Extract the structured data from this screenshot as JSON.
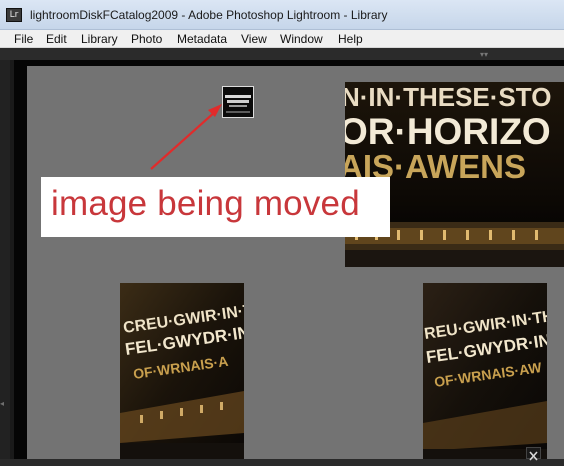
{
  "window": {
    "title": "lightroomDiskFCatalog2009 - Adobe Photoshop Lightroom - Library",
    "icon": "lightroom-app-icon",
    "icon_glyph": "Lr"
  },
  "menu": {
    "items": [
      "File",
      "Edit",
      "Library",
      "Photo",
      "Metadata",
      "View",
      "Window",
      "Help"
    ]
  },
  "annotation": {
    "text": "image being moved",
    "color": "#c8373b",
    "arrow_color": "#e12b2b"
  },
  "photos": [
    {
      "name": "landscape-photo",
      "inscription_lines": [
        "N·IN·THESE·STO",
        "OR·HORIZO",
        "AIS·AWENS"
      ]
    },
    {
      "name": "portrait-photo-left",
      "inscription_lines": [
        "CREU·GWIR·IN·THE",
        "FEL·GWYDR·IN",
        "OF·WRNAIS·A"
      ]
    },
    {
      "name": "portrait-photo-right",
      "inscription_lines": [
        "REU·GWIR·IN·THES",
        "FEL·GWYDR·IN",
        "OF·WRNAIS·AW"
      ]
    }
  ],
  "icons": {
    "collapse_top": "collapse-top-panel-icon",
    "collapse_left": "collapse-left-panel-icon",
    "close": "close-icon"
  }
}
